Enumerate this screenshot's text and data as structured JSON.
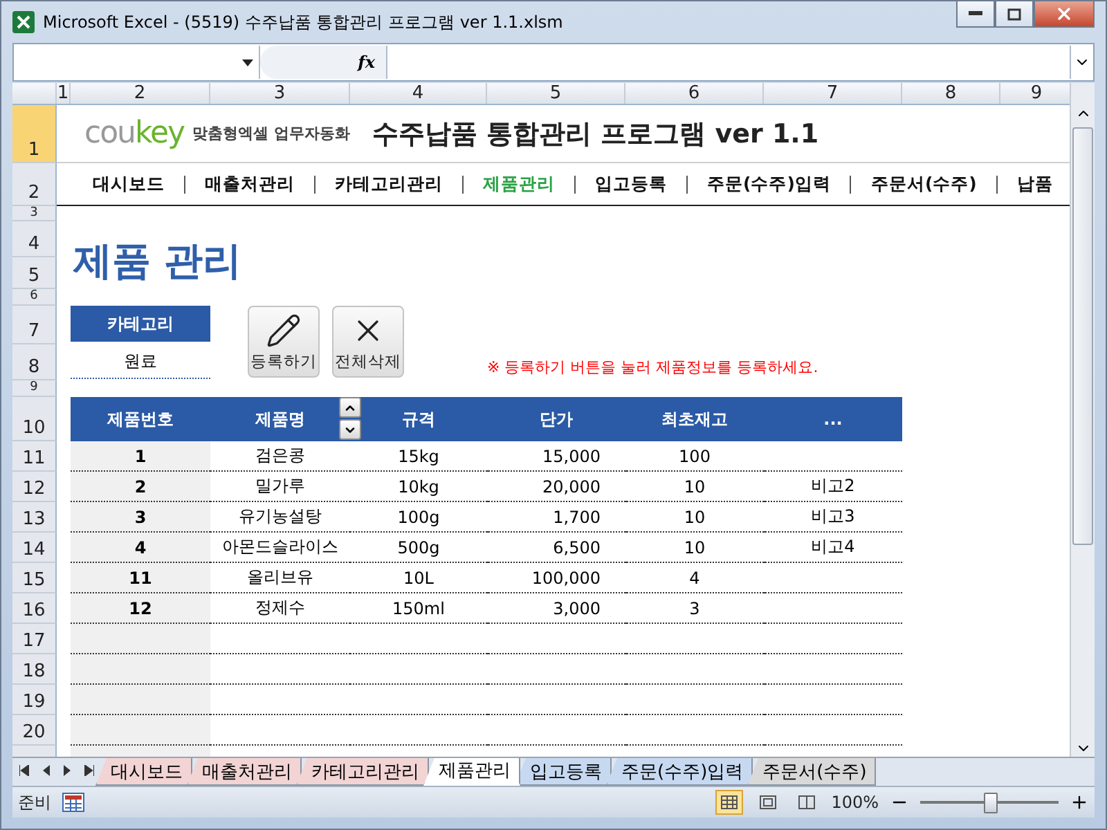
{
  "window": {
    "title": "Microsoft Excel - (5519) 수주납품 통합관리 프로그램 ver 1.1.xlsm"
  },
  "formula_bar": {
    "fx": "fx"
  },
  "column_headers": [
    "1",
    "2",
    "3",
    "4",
    "5",
    "6",
    "7",
    "8",
    "9"
  ],
  "row_headers": [
    "1",
    "2",
    "3",
    "4",
    "5",
    "6",
    "7",
    "8",
    "9",
    "10",
    "11",
    "12",
    "13",
    "14",
    "15",
    "16",
    "17",
    "18",
    "19",
    "20"
  ],
  "brand": {
    "logo_a": "cou",
    "logo_b": "key",
    "tagline": "맞춤형엑셀 업무자동화",
    "title": "수주납품 통합관리 프로그램 ver 1.1"
  },
  "nav": [
    {
      "label": "대시보드",
      "selected": false
    },
    {
      "label": "매출처관리",
      "selected": false
    },
    {
      "label": "카테고리관리",
      "selected": false
    },
    {
      "label": "제품관리",
      "selected": true
    },
    {
      "label": "입고등록",
      "selected": false
    },
    {
      "label": "주문(수주)입력",
      "selected": false
    },
    {
      "label": "주문서(수주)",
      "selected": false
    },
    {
      "label": "납품",
      "selected": false
    }
  ],
  "heading": "제품 관리",
  "category": {
    "label": "카테고리",
    "value": "원료"
  },
  "buttons": [
    {
      "kind": "edit",
      "label": "등록하기"
    },
    {
      "kind": "delete",
      "label": "전체삭제"
    }
  ],
  "note": "※ 등록하기 버튼을 눌러 제품정보를 등록하세요.",
  "table": {
    "columns": [
      "제품번호",
      "제품명",
      "규격",
      "단가",
      "최초재고",
      "..."
    ],
    "rows": [
      [
        "1",
        "검은콩",
        "15kg",
        "15,000",
        "100",
        ""
      ],
      [
        "2",
        "밀가루",
        "10kg",
        "20,000",
        "10",
        "비고2"
      ],
      [
        "3",
        "유기농설탕",
        "100g",
        "1,700",
        "10",
        "비고3"
      ],
      [
        "4",
        "아몬드슬라이스",
        "500g",
        "6,500",
        "10",
        "비고4"
      ],
      [
        "11",
        "올리브유",
        "10L",
        "100,000",
        "4",
        ""
      ],
      [
        "12",
        "정제수",
        "150ml",
        "3,000",
        "3",
        ""
      ]
    ]
  },
  "sheet_tabs": [
    {
      "label": "대시보드",
      "selected": false,
      "color": "#f2d4d4"
    },
    {
      "label": "매출처관리",
      "selected": false,
      "color": "#f2d4d4"
    },
    {
      "label": "카테고리관리",
      "selected": false,
      "color": "#f2d4d4"
    },
    {
      "label": "제품관리",
      "selected": true,
      "color": "#ffffff"
    },
    {
      "label": "입고등록",
      "selected": false,
      "color": "#c6d9f1"
    },
    {
      "label": "주문(수주)입력",
      "selected": false,
      "color": "#c6d9f1"
    },
    {
      "label": "주문서(수주)",
      "selected": false,
      "color": "#d9d9d9"
    }
  ],
  "status_bar": {
    "status": "준비",
    "zoom": "100%",
    "zoom_slider": {
      "level": 0.5
    }
  }
}
